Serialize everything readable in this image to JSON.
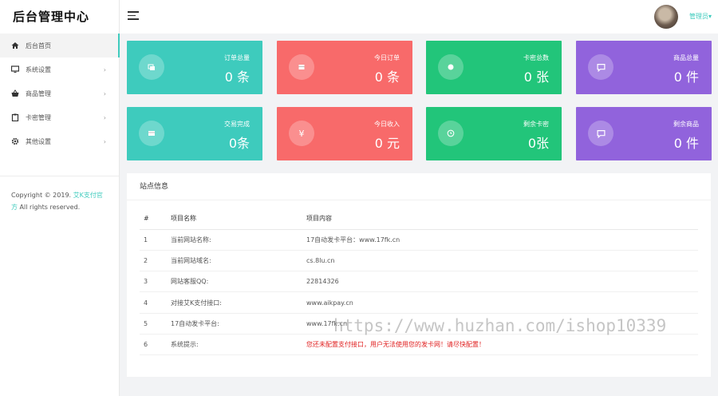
{
  "sidebar": {
    "brand": "后台管理中心",
    "items": [
      {
        "label": "后台首页",
        "icon": "home-icon",
        "active": true,
        "chevron": ""
      },
      {
        "label": "系统设置",
        "icon": "monitor-icon",
        "active": false,
        "chevron": "›"
      },
      {
        "label": "商品管理",
        "icon": "basket-icon",
        "active": false,
        "chevron": "›"
      },
      {
        "label": "卡密管理",
        "icon": "clipboard-icon",
        "active": false,
        "chevron": "›"
      },
      {
        "label": "其他设置",
        "icon": "gear-icon",
        "active": false,
        "chevron": "›"
      }
    ],
    "copyright_prefix": "Copyright © 2019. ",
    "copyright_link": "艾K支付官方",
    "copyright_suffix": " All rights reserved."
  },
  "header": {
    "user_name": "管理员▾"
  },
  "cards": [
    {
      "label": "订单总量",
      "value": "0 条",
      "color": "#3ecbbd",
      "icon": "stack-icon"
    },
    {
      "label": "今日订单",
      "value": "0 条",
      "color": "#f86a6a",
      "icon": "box-icon"
    },
    {
      "label": "卡密总数",
      "value": "0 张",
      "color": "#22c57a",
      "icon": "dot-icon"
    },
    {
      "label": "商品总量",
      "value": "0 件",
      "color": "#9163dc",
      "icon": "chat-icon"
    },
    {
      "label": "交易完成",
      "value": "0条",
      "color": "#3ecbbd",
      "icon": "card-icon"
    },
    {
      "label": "今日收入",
      "value": "0 元",
      "color": "#f86a6a",
      "icon": "yen-icon"
    },
    {
      "label": "剩余卡密",
      "value": "0张",
      "color": "#22c57a",
      "icon": "clock-icon"
    },
    {
      "label": "剩余商品",
      "value": "0 件",
      "color": "#9163dc",
      "icon": "chat-icon"
    }
  ],
  "site_info": {
    "title": "站点信息",
    "headers": [
      "#",
      "项目名称",
      "项目内容"
    ],
    "rows": [
      {
        "num": "1",
        "name": "当前网站名称:",
        "content": "17自动发卡平台：www.17fk.cn",
        "warn": false
      },
      {
        "num": "2",
        "name": "当前网站域名:",
        "content": "cs.8lu.cn",
        "warn": false
      },
      {
        "num": "3",
        "name": "网站客服QQ:",
        "content": "22814326",
        "warn": false
      },
      {
        "num": "4",
        "name": "对接艾K支付接口:",
        "content": "www.aikpay.cn",
        "warn": false
      },
      {
        "num": "5",
        "name": "17自动发卡平台:",
        "content": "www.17fk.cn",
        "warn": false
      },
      {
        "num": "6",
        "name": "系统提示:",
        "content": "您还未配置支付接口，用户无法使用您的发卡网！请尽快配置！",
        "warn": true
      }
    ]
  },
  "watermark": "https://www.huzhan.com/ishop10339"
}
